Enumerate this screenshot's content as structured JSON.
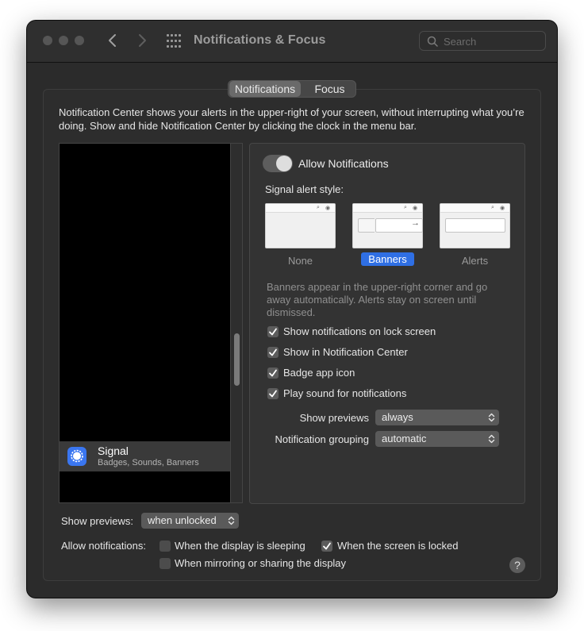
{
  "window": {
    "title": "Notifications & Focus",
    "search_placeholder": "Search"
  },
  "tabs": [
    {
      "label": "Notifications",
      "selected": true
    },
    {
      "label": "Focus",
      "selected": false
    }
  ],
  "description": "Notification Center shows your alerts in the upper-right of your screen, without interrupting what you’re doing. Show and hide Notification Center by clicking the clock in the menu bar.",
  "app_list": [
    {
      "name": "Signal",
      "subtitle": "Badges, Sounds, Banners",
      "icon": "signal-icon",
      "selected": true
    }
  ],
  "panel": {
    "allow_label": "Allow Notifications",
    "allow_on": false,
    "alert_style_label": "Signal alert style:",
    "alert_styles": [
      {
        "label": "None",
        "selected": false
      },
      {
        "label": "Banners",
        "selected": true
      },
      {
        "label": "Alerts",
        "selected": false
      }
    ],
    "hint": "Banners appear in the upper-right corner and go away automatically. Alerts stay on screen until dismissed.",
    "checkboxes": [
      {
        "label": "Show notifications on lock screen",
        "checked": true
      },
      {
        "label": "Show in Notification Center",
        "checked": true
      },
      {
        "label": "Badge app icon",
        "checked": true
      },
      {
        "label": "Play sound for notifications",
        "checked": true
      }
    ],
    "show_previews": {
      "label": "Show previews",
      "value": "always"
    },
    "grouping": {
      "label": "Notification grouping",
      "value": "automatic"
    }
  },
  "footer": {
    "show_previews_label": "Show previews:",
    "show_previews_value": "when unlocked",
    "allow_label": "Allow notifications:",
    "options": [
      {
        "label": "When the display is sleeping",
        "checked": false
      },
      {
        "label": "When the screen is locked",
        "checked": true
      },
      {
        "label": "When mirroring or sharing the display",
        "checked": false
      }
    ],
    "help": "?"
  },
  "colors": {
    "accent": "#2f6fe4",
    "window_bg": "#2b2b2b",
    "signal_blue": "#3a76f0"
  }
}
